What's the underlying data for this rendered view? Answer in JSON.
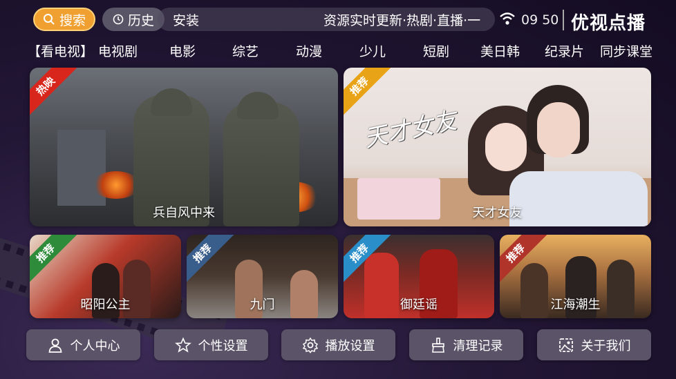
{
  "topbar": {
    "search_label": "搜索",
    "history_label": "历史",
    "ticker_text_1": "安装",
    "ticker_text_2": "资源实时更新·热剧·直播·一",
    "clock": "09 50",
    "brand": "优视点播"
  },
  "nav": {
    "items": [
      "【看电视】",
      "电视剧",
      "电影",
      "综艺",
      "动漫",
      "少儿",
      "短剧",
      "美日韩",
      "纪录片",
      "同步课堂"
    ]
  },
  "featured": [
    {
      "title": "兵自风中来",
      "badge": "热映",
      "badge_color": "#d8261c"
    },
    {
      "title": "天才女友",
      "badge": "推荐",
      "badge_color": "#e8a317",
      "logo_text": "天才女友"
    }
  ],
  "recommended": [
    {
      "title": "昭阳公主",
      "badge": "推荐",
      "badge_color": "#2e8b3a"
    },
    {
      "title": "九门",
      "badge": "推荐",
      "badge_color": "#3a5e8c"
    },
    {
      "title": "御廷谣",
      "badge": "推荐",
      "badge_color": "#2a8ec8"
    },
    {
      "title": "江海潮生",
      "badge": "推荐",
      "badge_color": "#b0342a"
    }
  ],
  "buttons": [
    {
      "label": "个人中心",
      "icon": "user-icon"
    },
    {
      "label": "个性设置",
      "icon": "star-icon"
    },
    {
      "label": "播放设置",
      "icon": "gear-icon"
    },
    {
      "label": "清理记录",
      "icon": "clean-icon"
    },
    {
      "label": "关于我们",
      "icon": "image-icon"
    }
  ]
}
